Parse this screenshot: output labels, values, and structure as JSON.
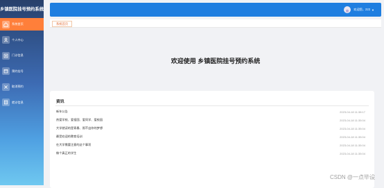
{
  "sidebar": {
    "title": "乡镇医院挂号预约系统",
    "items": [
      {
        "label": "系统首页",
        "icon": "home-icon",
        "active": true
      },
      {
        "label": "个人中心",
        "icon": "user-icon",
        "active": false
      },
      {
        "label": "门诊信息",
        "icon": "clinic-icon",
        "active": false
      },
      {
        "label": "预约挂号",
        "icon": "calendar-icon",
        "active": false
      },
      {
        "label": "取消预约",
        "icon": "cancel-icon",
        "active": false
      },
      {
        "label": "就诊信息",
        "icon": "document-icon",
        "active": false
      }
    ]
  },
  "header": {
    "user_label": "欢迎您，222",
    "caret": "▼"
  },
  "tabs": [
    {
      "label": "系统首页"
    }
  ],
  "main": {
    "welcome": "欢迎使用 乡镇医院挂号预约系统",
    "news": {
      "title": "资讯",
      "items": [
        {
          "title": "新年公告",
          "date": "2023-04-18 11:38:17"
        },
        {
          "title": "热爱学校、爱祖国、爱同学、爱校园",
          "date": "2023-04-18 11:35:04"
        },
        {
          "title": "大学就读的是青春、照不出你的梦想",
          "date": "2023-04-18 11:35:04"
        },
        {
          "title": "最受欢迎的教育培训",
          "date": "2023-04-18 11:35:04"
        },
        {
          "title": "在大学需要注意的这个事项",
          "date": "2023-04-18 11:35:04"
        },
        {
          "title": "做个真正的学生",
          "date": "2023-04-18 11:35:04"
        }
      ]
    }
  },
  "watermark": "CSDN @一点毕设",
  "colors": {
    "topbar": "#1e7ee0",
    "active_menu": "#ff7f3a",
    "tab_text": "#e2703a"
  }
}
